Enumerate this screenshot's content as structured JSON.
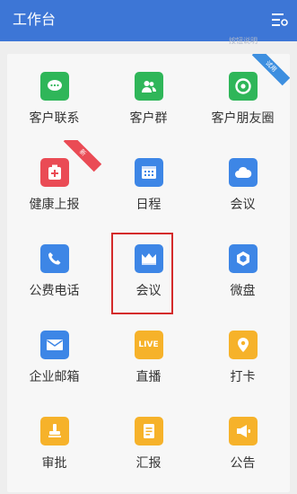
{
  "header": {
    "title": "工作台"
  },
  "sub_hint": "按钮说明",
  "grid": {
    "items": [
      {
        "label": "客户联系",
        "icon": "chat-bubble-icon",
        "color": "#2fb659"
      },
      {
        "label": "客户群",
        "icon": "people-icon",
        "color": "#2fb659"
      },
      {
        "label": "客户朋友圈",
        "icon": "aperture-icon",
        "color": "#2fb659",
        "badge": "试用",
        "badge_color": "#3d8fe0"
      },
      {
        "label": "健康上报",
        "icon": "medical-kit-icon",
        "color": "#ea4b55",
        "badge": "新",
        "badge_color": "#ea4b55"
      },
      {
        "label": "日程",
        "icon": "calendar-icon",
        "color": "#3d86e6"
      },
      {
        "label": "会议",
        "icon": "cloud-icon",
        "color": "#3d86e6"
      },
      {
        "label": "公费电话",
        "icon": "phone-icon",
        "color": "#3d86e6"
      },
      {
        "label": "会议",
        "icon": "crown-icon",
        "color": "#3d86e6"
      },
      {
        "label": "微盘",
        "icon": "drive-icon",
        "color": "#3d86e6"
      },
      {
        "label": "企业邮箱",
        "icon": "mail-icon",
        "color": "#3d86e6"
      },
      {
        "label": "直播",
        "icon": "live-icon",
        "color": "#f6b22a",
        "icon_text": "LIVE"
      },
      {
        "label": "打卡",
        "icon": "location-pin-icon",
        "color": "#f6b22a"
      },
      {
        "label": "审批",
        "icon": "stamp-icon",
        "color": "#f6b22a"
      },
      {
        "label": "汇报",
        "icon": "document-icon",
        "color": "#f6b22a"
      },
      {
        "label": "公告",
        "icon": "megaphone-icon",
        "color": "#f6b22a"
      }
    ]
  }
}
